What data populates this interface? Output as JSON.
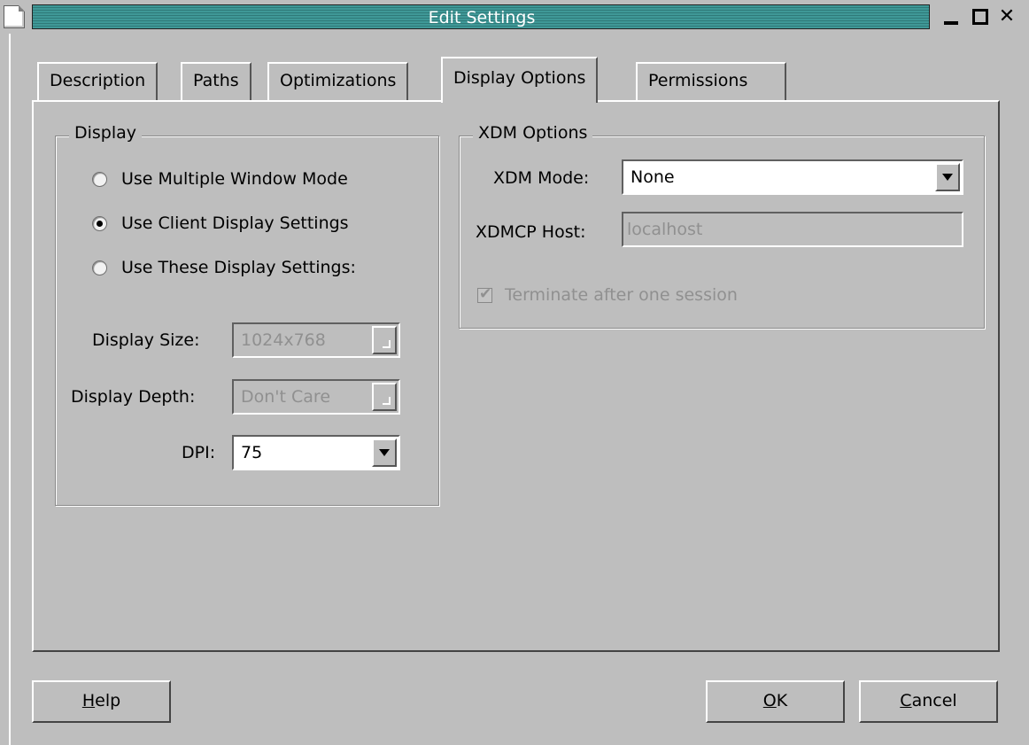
{
  "window": {
    "title": "Edit Settings"
  },
  "tabs": [
    {
      "label": "Description"
    },
    {
      "label": "Paths"
    },
    {
      "label": "Optimizations"
    },
    {
      "label": "Display Options",
      "active": true
    },
    {
      "label": "Permissions"
    }
  ],
  "display_group": {
    "title": "Display",
    "radios": [
      {
        "label": "Use Multiple Window Mode",
        "checked": false
      },
      {
        "label": "Use Client Display Settings",
        "checked": true
      },
      {
        "label": "Use These Display Settings:",
        "checked": false
      }
    ],
    "display_size": {
      "label": "Display Size:",
      "value": "1024x768",
      "enabled": false
    },
    "display_depth": {
      "label": "Display Depth:",
      "value": "Don't Care",
      "enabled": false
    },
    "dpi": {
      "label": "DPI:",
      "value": "75",
      "enabled": true
    }
  },
  "xdm_group": {
    "title": "XDM Options",
    "mode": {
      "label": "XDM Mode:",
      "value": "None"
    },
    "host": {
      "label": "XDMCP Host:",
      "value": "localhost",
      "enabled": false
    },
    "terminate": {
      "label": "Terminate after one session",
      "checked": true,
      "enabled": false
    }
  },
  "buttons": {
    "help": {
      "mnemonic": "H",
      "rest": "elp"
    },
    "ok": {
      "mnemonic": "O",
      "rest": "K"
    },
    "cancel": {
      "mnemonic": "C",
      "rest": "ancel"
    }
  }
}
